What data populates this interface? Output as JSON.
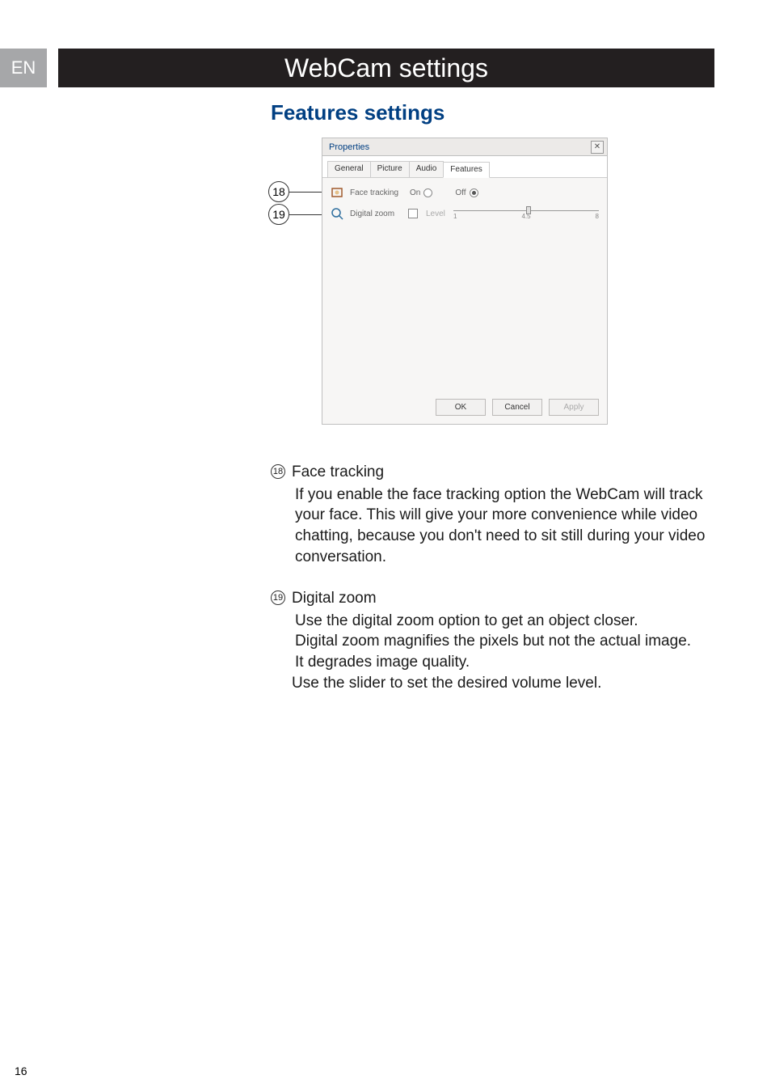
{
  "lang": "EN",
  "title": "WebCam settings",
  "subtitle": "Features settings",
  "dialog": {
    "window_title": "Properties",
    "tabs": [
      "General",
      "Picture",
      "Audio",
      "Features"
    ],
    "active_tab": 3,
    "face_tracking": {
      "label": "Face tracking",
      "on_label": "On",
      "off_label": "Off",
      "selected": "off"
    },
    "digital_zoom": {
      "label": "Digital zoom",
      "level_label": "Level",
      "min_tick": "1",
      "mid_tick": "4.5",
      "max_tick": "8",
      "value": 4.5
    },
    "buttons": {
      "ok": "OK",
      "cancel": "Cancel",
      "apply": "Apply"
    }
  },
  "callouts": {
    "c18": "18",
    "c19": "19"
  },
  "sections": {
    "s18": {
      "num": "18",
      "title": "Face tracking",
      "para": "If you enable the face tracking option the WebCam will track your face. This will give your more convenience while video chatting, because you don't need to sit still during your video conversation."
    },
    "s19": {
      "num": "19",
      "title": "Digital zoom",
      "para1": "Use the digital zoom option to get an object closer.",
      "para2": "Digital zoom magnifies the pixels but not the actual image.",
      "para3": "It degrades image quality.",
      "para4": "Use the slider to set the desired volume level."
    }
  },
  "page_number": "16"
}
